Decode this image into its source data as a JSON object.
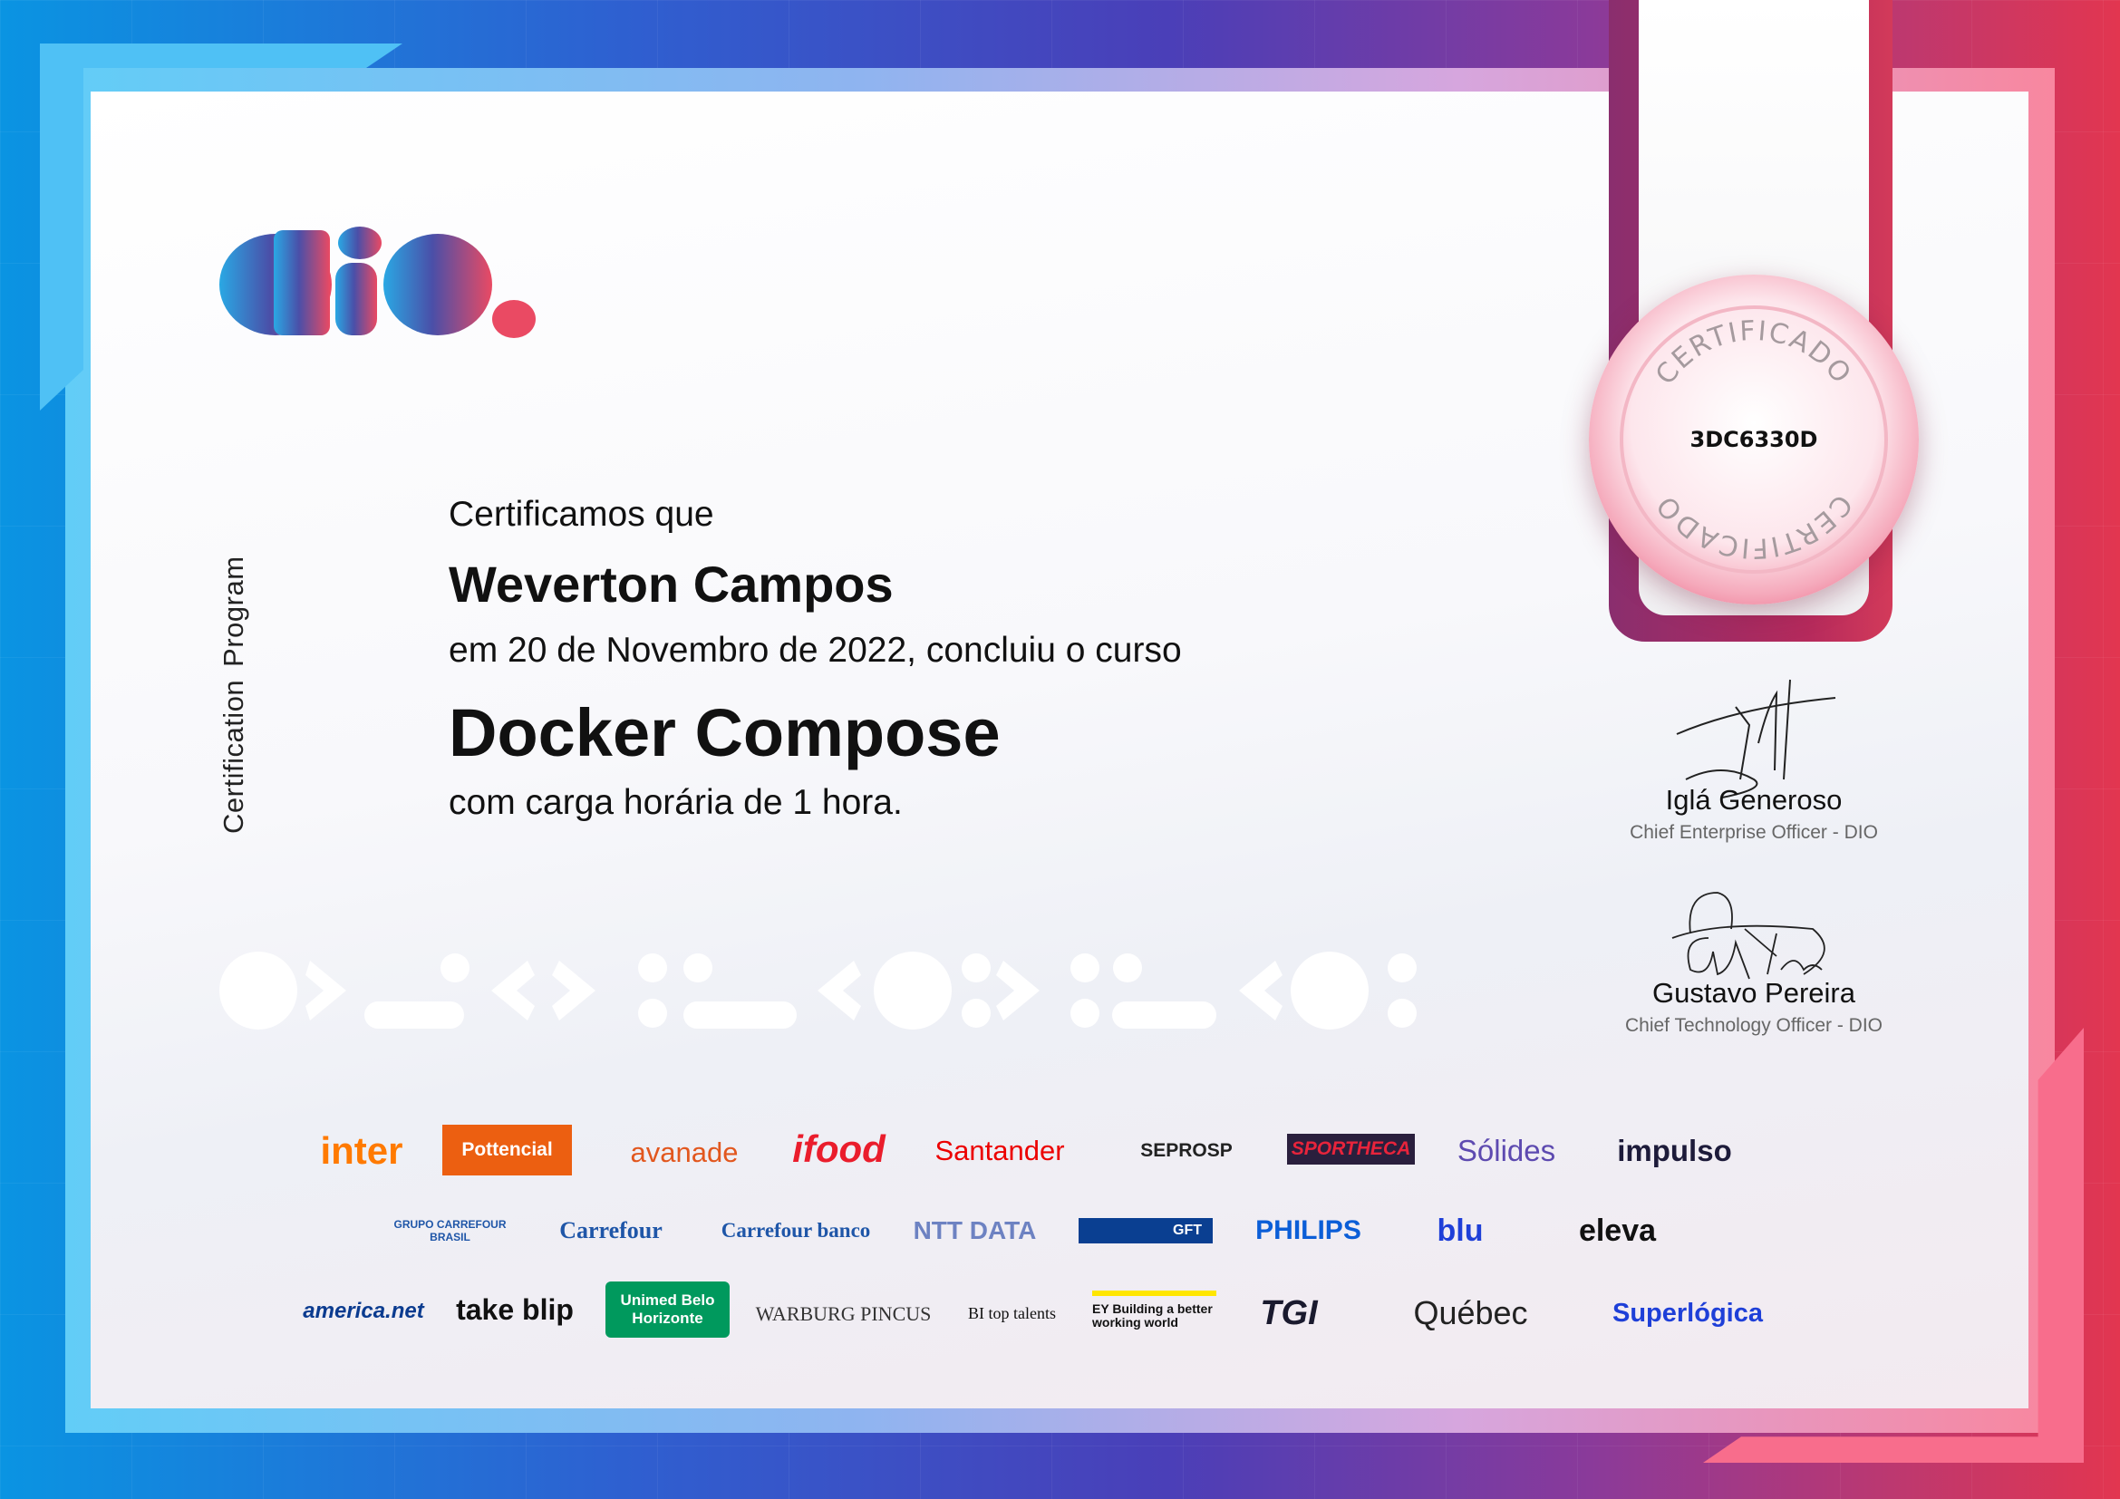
{
  "brand": {
    "logo_text": "dio.",
    "colors": {
      "blue": "#2fa6e6",
      "purple": "#4a4fa8",
      "red": "#ea4a63"
    }
  },
  "side_label": {
    "part1": "Certification",
    "part2": "Program"
  },
  "body": {
    "intro": "Certificamos que",
    "student_name": "Weverton Campos",
    "completion": "em 20 de Novembro de 2022, concluiu o curso",
    "course": "Docker Compose",
    "workload": "com carga horária de 1 hora."
  },
  "seal": {
    "code": "3DC6330D",
    "ring_text": "CERTIFICADO"
  },
  "signatories": [
    {
      "name": "Iglá Generoso",
      "role": "Chief Enterprise Officer - DIO"
    },
    {
      "name": "Gustavo Pereira",
      "role": "Chief Technology Officer - DIO"
    }
  ],
  "partners": {
    "row1": [
      "inter",
      "Pottencial",
      "avanade",
      "ifood",
      "Santander",
      "SEPROSP",
      "SPORTHECA",
      "Sólides",
      "impulso"
    ],
    "row2": [
      "GRUPO CARREFOUR BRASIL",
      "Carrefour",
      "Carrefour banco",
      "NTT DATA",
      "GFT",
      "PHILIPS",
      "blu",
      "eleva"
    ],
    "row3": [
      "america.net",
      "take blip",
      "Unimed Belo Horizonte",
      "WARBURG PINCUS",
      "BI top talents",
      "EY Building a better working world",
      "TGI",
      "Québec",
      "Superlógica"
    ]
  }
}
